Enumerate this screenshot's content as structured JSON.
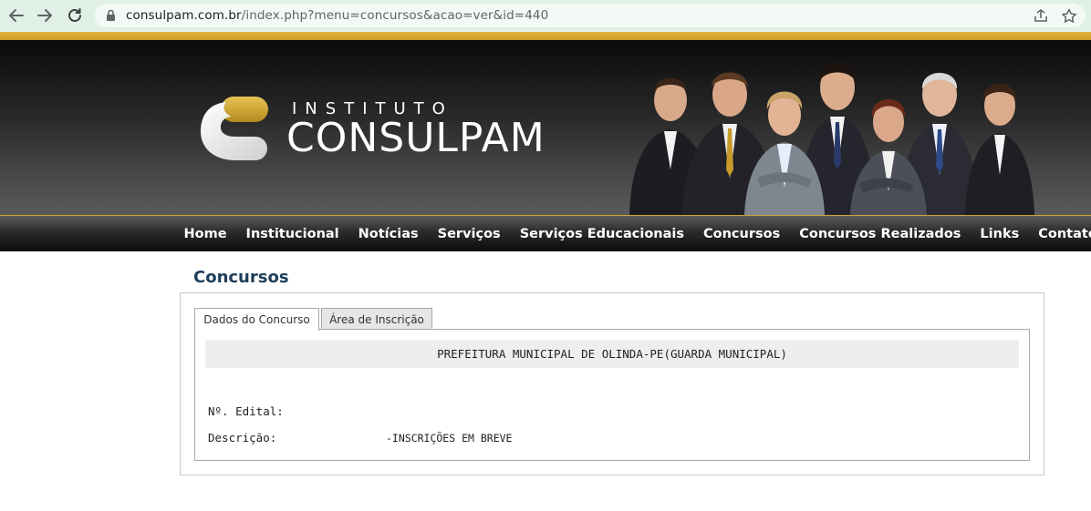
{
  "browser": {
    "url_host": "consulpam.com.br",
    "url_path": "/index.php?menu=concursos&acao=ver&id=440"
  },
  "header": {
    "logo_line1": "INSTITUTO",
    "logo_line2": "CONSULPAM"
  },
  "menu": {
    "items": [
      "Home",
      "Institucional",
      "Notícias",
      "Serviços",
      "Serviços Educacionais",
      "Concursos",
      "Concursos Realizados",
      "Links",
      "Contato"
    ]
  },
  "main": {
    "title": "Concursos",
    "tabs": [
      {
        "label": "Dados do Concurso",
        "active": true
      },
      {
        "label": "Área de Inscrição",
        "active": false
      }
    ],
    "concurso_name": "PREFEITURA MUNICIPAL DE OLINDA-PE(GUARDA MUNICIPAL)",
    "fields": [
      {
        "label": "Nº. Edital:",
        "value": ""
      },
      {
        "label": "Descrição:",
        "value": "-INSCRIÇÕES EM BREVE"
      }
    ]
  },
  "colors": {
    "chrome_bg": "#e1f0e6",
    "gold": "#e4b43a",
    "title_blue": "#1f3e5a"
  }
}
